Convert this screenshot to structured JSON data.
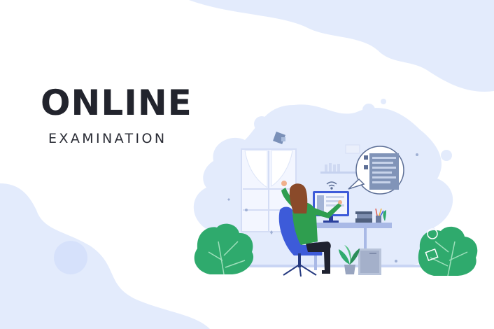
{
  "banner": {
    "title": "ONLINE",
    "subtitle": "EXAMINATION"
  },
  "palette": {
    "background": "#ffffff",
    "blob_light": "#e3ebfc",
    "blob_mid": "#d3defa",
    "text_dark": "#22242d",
    "chair": "#3d5bd9",
    "shirt": "#2f9e4f",
    "hair": "#8a4a2a",
    "plant": "#2faa6d",
    "desk": "#b9c6ea",
    "monitor": "#3d5bd9"
  },
  "icons": [
    "window-icon",
    "wifi-icon",
    "speech-bubble-icon",
    "computer-monitor-icon",
    "cpu-tower-icon",
    "books-icon",
    "plant-icon",
    "chair-icon"
  ]
}
